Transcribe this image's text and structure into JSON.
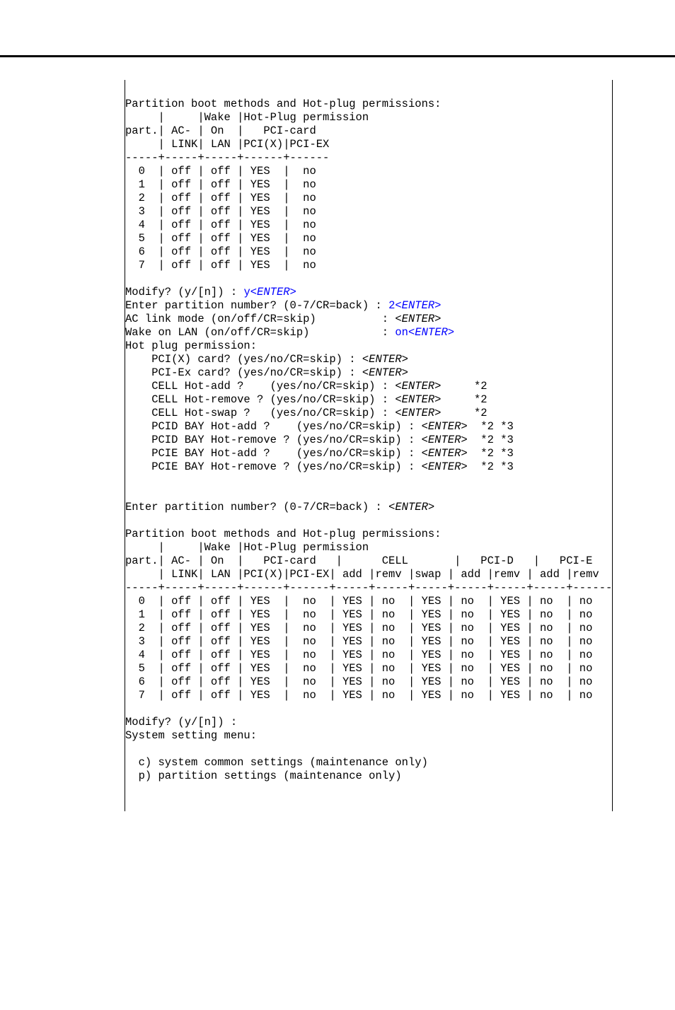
{
  "section1": {
    "title": "Partition boot methods and Hot-plug permissions:",
    "header": {
      "l1": "     |     |Wake |Hot-Plug permission",
      "l2": "part.| AC- | On  |   PCI-card",
      "l3": "     | LINK| LAN |PCI(X)|PCI-EX",
      "sep": "-----+-----+-----+------+------"
    },
    "rows": [
      "  0  | off | off | YES  |  no",
      "  1  | off | off | YES  |  no",
      "  2  | off | off | YES  |  no",
      "  3  | off | off | YES  |  no",
      "  4  | off | off | YES  |  no",
      "  5  | off | off | YES  |  no",
      "  6  | off | off | YES  |  no",
      "  7  | off | off | YES  |  no"
    ]
  },
  "prompts": {
    "modify_label": "Modify? (y/[n]) : ",
    "modify_input": "y",
    "enter1": "<ENTER>",
    "part_label": "Enter partition number? (0-7/CR=back) : ",
    "part_input": "2",
    "enter2": "<ENTER>",
    "ac_link_label": "AC link mode (on/off/CR=skip)          : ",
    "ac_link_enter": "<ENTER>",
    "wake_label": "Wake on LAN (on/off/CR=skip)           : ",
    "wake_input": "on",
    "wake_enter": "<ENTER>"
  },
  "hotplug": {
    "title": "Hot plug permission:",
    "pcix_label": "    PCI(X) card? (yes/no/CR=skip) : ",
    "pcix_enter": "<ENTER>",
    "pciex_label": "    PCI-Ex card? (yes/no/CR=skip) : ",
    "pciex_enter": "<ENTER>",
    "cell_add_label": "    CELL Hot-add ?    (yes/no/CR=skip) : ",
    "cell_add_enter": "<ENTER>",
    "cell_add_suffix": "     *2",
    "cell_rem_label": "    CELL Hot-remove ? (yes/no/CR=skip) : ",
    "cell_rem_enter": "<ENTER>",
    "cell_rem_suffix": "     *2",
    "cell_swap_label": "    CELL Hot-swap ?   (yes/no/CR=skip) : ",
    "cell_swap_enter": "<ENTER>",
    "cell_swap_suffix": "     *2",
    "pcid_add_label": "    PCID BAY Hot-add ?    (yes/no/CR=skip) : ",
    "pcid_add_enter": "<ENTER>",
    "pcid_add_suffix": "  *2 *3",
    "pcid_rem_label": "    PCID BAY Hot-remove ? (yes/no/CR=skip) : ",
    "pcid_rem_enter": "<ENTER>",
    "pcid_rem_suffix": "  *2 *3",
    "pcie_add_label": "    PCIE BAY Hot-add ?    (yes/no/CR=skip) : ",
    "pcie_add_enter": "<ENTER>",
    "pcie_add_suffix": "  *2 *3",
    "pcie_rem_label": "    PCIE BAY Hot-remove ? (yes/no/CR=skip) : ",
    "pcie_rem_enter": "<ENTER>",
    "pcie_rem_suffix": "  *2 *3"
  },
  "post": {
    "part_label": "Enter partition number? (0-7/CR=back) : ",
    "part_enter": "<ENTER>"
  },
  "section2": {
    "title": "Partition boot methods and Hot-plug permissions:",
    "header": {
      "l1": "     |     |Wake |Hot-Plug permission",
      "l2": "part.| AC- | On  |   PCI-card   |      CELL       |   PCI-D   |   PCI-E",
      "l3": "     | LINK| LAN |PCI(X)|PCI-EX| add |remv |swap | add |remv | add |remv",
      "sep": "-----+-----+-----+------+------+-----+-----+-----+-----+-----+-----+------"
    },
    "rows": [
      "  0  | off | off | YES  |  no  | YES | no  | YES | no  | YES | no  | no",
      "  1  | off | off | YES  |  no  | YES | no  | YES | no  | YES | no  | no",
      "  2  | off | off | YES  |  no  | YES | no  | YES | no  | YES | no  | no",
      "  3  | off | off | YES  |  no  | YES | no  | YES | no  | YES | no  | no",
      "  4  | off | off | YES  |  no  | YES | no  | YES | no  | YES | no  | no",
      "  5  | off | off | YES  |  no  | YES | no  | YES | no  | YES | no  | no",
      "  6  | off | off | YES  |  no  | YES | no  | YES | no  | YES | no  | no",
      "  7  | off | off | YES  |  no  | YES | no  | YES | no  | YES | no  | no"
    ]
  },
  "trailer": {
    "modify": "Modify? (y/[n]) :",
    "menu_title": "System setting menu:",
    "item_c": "  c) system common settings (maintenance only)",
    "item_p": "  p) partition settings (maintenance only)"
  }
}
